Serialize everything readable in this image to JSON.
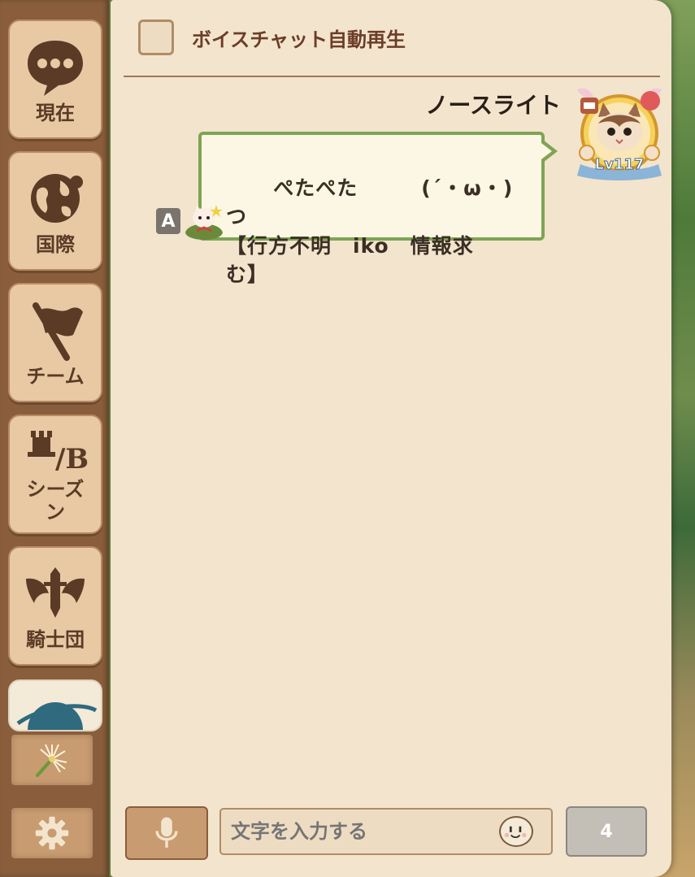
{
  "sidebar": {
    "tabs": [
      {
        "label": "現在",
        "icon": "speech-bubble-icon"
      },
      {
        "label": "国際",
        "icon": "globe-icon"
      },
      {
        "label": "チーム",
        "icon": "flag-icon"
      },
      {
        "label": "シーズン",
        "icon": "season-rank-icon",
        "icon_text": "/B"
      },
      {
        "label": "騎士団",
        "icon": "knight-emblem-icon"
      },
      {
        "label": "",
        "icon": "planet-icon"
      }
    ],
    "tools": [
      {
        "icon": "dandelion-icon"
      },
      {
        "icon": "gear-icon"
      }
    ]
  },
  "header": {
    "checkbox_label": "ボイスチャット自動再生",
    "checkbox_checked": false
  },
  "messages": [
    {
      "sender": "ノースライト",
      "level": "Lv117",
      "text": "ぺたぺた　　　(´・ω・)つ\n【行方不明　iko　情報求\nむ】",
      "lang_badge": "A"
    }
  ],
  "input": {
    "placeholder": "文字を入力する",
    "send_count": "4"
  },
  "colors": {
    "panel_bg": "#f3e4cd",
    "sidebar_bg": "#8a5e3c",
    "bubble_border": "#7ea454",
    "header_text": "#6b3d27"
  }
}
